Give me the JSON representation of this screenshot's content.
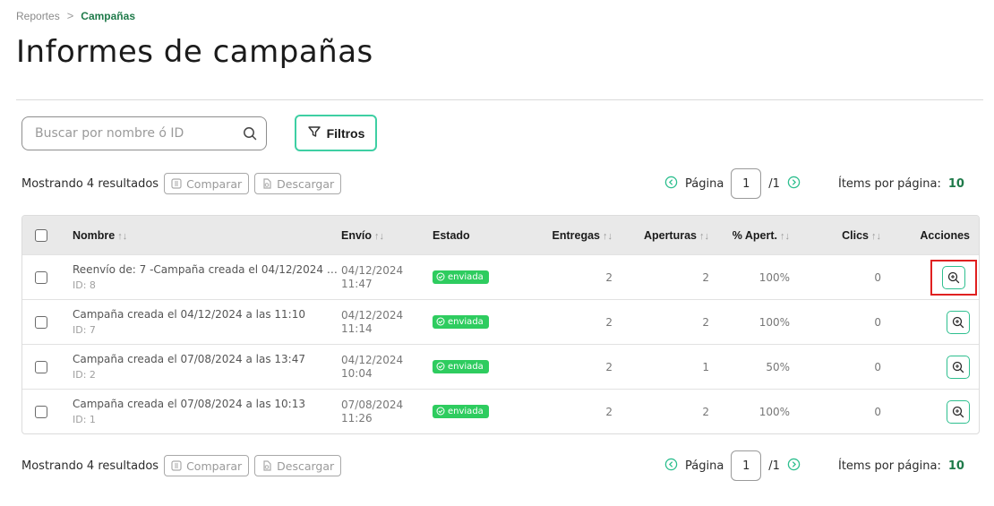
{
  "breadcrumb": {
    "parent": "Reportes",
    "current": "Campañas"
  },
  "title": "Informes de campañas",
  "search": {
    "placeholder": "Buscar por nombre ó ID",
    "value": ""
  },
  "filters_label": "Filtros",
  "toolbar": {
    "results": "Mostrando 4 resultados",
    "compare": "Comparar",
    "download": "Descargar",
    "page_label": "Página",
    "page_current": "1",
    "page_total": "/1",
    "items_label": "Ítems por página:",
    "items_count": "10"
  },
  "table": {
    "headers": {
      "name": "Nombre",
      "sent": "Envío",
      "status": "Estado",
      "deliveries": "Entregas",
      "opens": "Aperturas",
      "open_pct": "% Apert.",
      "clicks": "Clics",
      "actions": "Acciones"
    },
    "rows": [
      {
        "name": "Reenvío de: 7 -Campaña creada el 04/12/2024 a las 1...",
        "id": "ID: 8",
        "date": "04/12/2024",
        "time": "11:47",
        "status": "enviada",
        "deliveries": "2",
        "opens": "2",
        "pct": "100%",
        "clicks": "0"
      },
      {
        "name": "Campaña creada el 04/12/2024 a las 11:10",
        "id": "ID: 7",
        "date": "04/12/2024",
        "time": "11:14",
        "status": "enviada",
        "deliveries": "2",
        "opens": "2",
        "pct": "100%",
        "clicks": "0"
      },
      {
        "name": "Campaña creada el 07/08/2024 a las 13:47",
        "id": "ID: 2",
        "date": "04/12/2024",
        "time": "10:04",
        "status": "enviada",
        "deliveries": "2",
        "opens": "1",
        "pct": "50%",
        "clicks": "0"
      },
      {
        "name": "Campaña creada el 07/08/2024 a las 10:13",
        "id": "ID: 1",
        "date": "07/08/2024",
        "time": "11:26",
        "status": "enviada",
        "deliveries": "2",
        "opens": "2",
        "pct": "100%",
        "clicks": "0"
      }
    ]
  },
  "colors": {
    "accent": "#3ecfa3",
    "brand_text": "#1f7a4a",
    "status_green": "#2ecc5f",
    "highlight_red": "#e02020"
  },
  "icons": {
    "search": "search-icon",
    "filter": "filter-icon",
    "compare": "compare-icon",
    "download": "download-icon",
    "prev": "chevron-left-circle-icon",
    "next": "chevron-right-circle-icon",
    "view": "zoom-in-icon",
    "check": "check-circle-icon"
  }
}
